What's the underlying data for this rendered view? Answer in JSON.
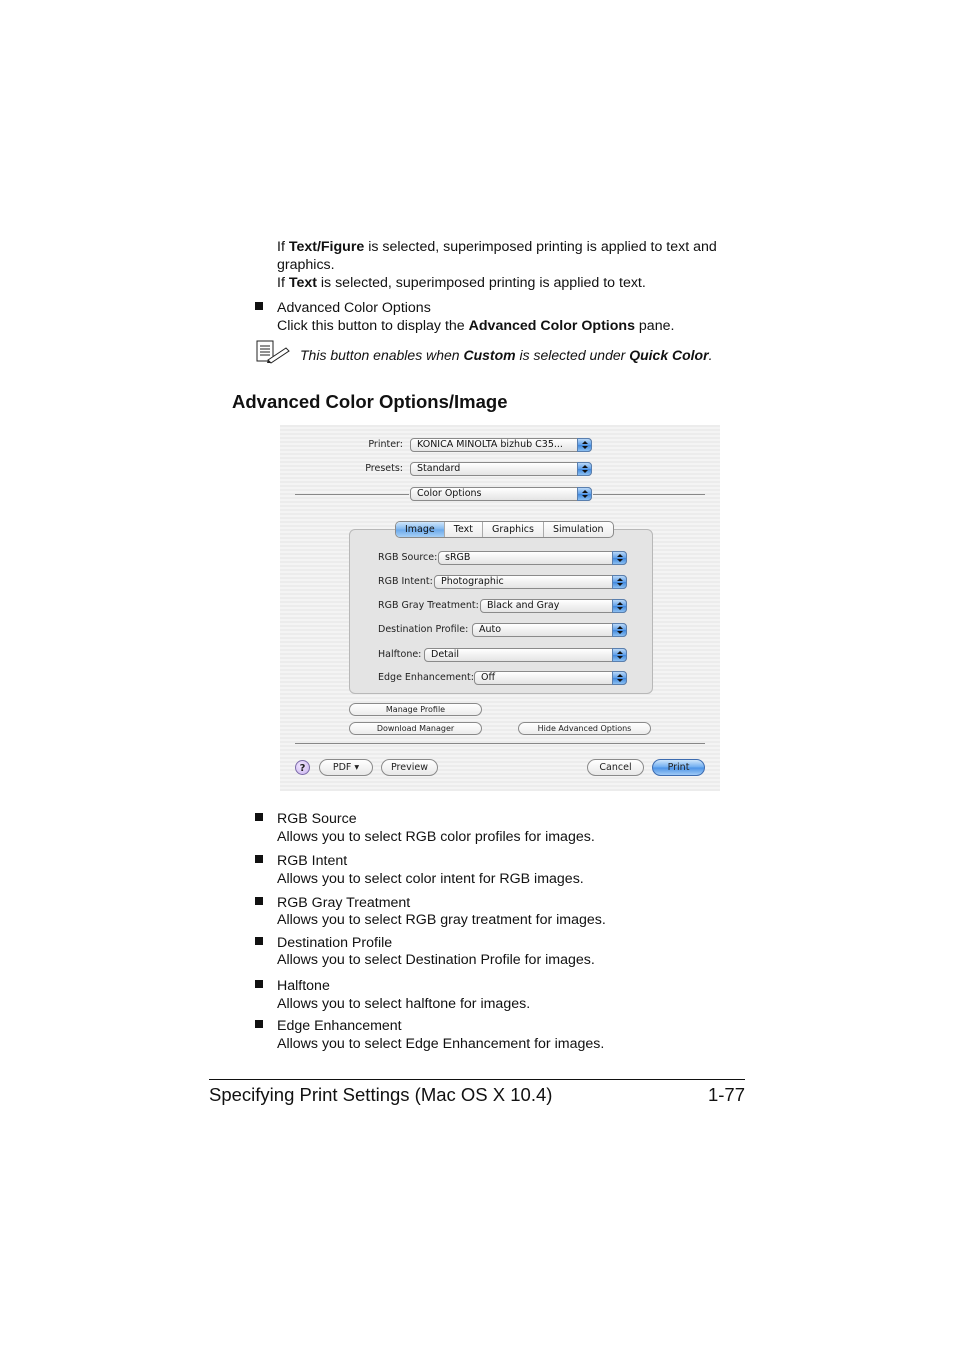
{
  "intro": {
    "line1_pre": "If ",
    "line1_bold": "Text/Figure",
    "line1_post": " is selected, superimposed printing is applied to text and",
    "line2": "graphics.",
    "line3_pre": "If ",
    "line3_bold": "Text",
    "line3_post": " is selected, superimposed printing is applied to text."
  },
  "advanced_item": {
    "title": "Advanced Color Options",
    "desc_pre": "Click this button to display the ",
    "desc_bold": "Advanced Color Options",
    "desc_post": " pane."
  },
  "note": {
    "icon": "note-pencil-icon",
    "pre": "This button enables when ",
    "bold1": "Custom",
    "mid": " is selected under ",
    "bold2": "Quick Color",
    "post": "."
  },
  "section_heading": "Advanced Color Options/Image",
  "dialog": {
    "printer_label": "Printer:",
    "printer_value": "KONICA MINOLTA bizhub C35...",
    "presets_label": "Presets:",
    "presets_value": "Standard",
    "pane_value": "Color Options",
    "tabs": [
      "Image",
      "Text",
      "Graphics",
      "Simulation"
    ],
    "active_tab": "Image",
    "fields": [
      {
        "label": "RGB Source:",
        "value": "sRGB"
      },
      {
        "label": "RGB Intent:",
        "value": "Photographic"
      },
      {
        "label": "RGB Gray Treatment:",
        "value": "Black and Gray"
      },
      {
        "label": "Destination Profile:",
        "value": "Auto"
      },
      {
        "label": "Halftone:",
        "value": "Detail"
      },
      {
        "label": "Edge Enhancement:",
        "value": "Off"
      }
    ],
    "manage_profile": "Manage Profile",
    "download_manager": "Download Manager",
    "hide_advanced": "Hide Advanced Options",
    "help": "?",
    "pdf": "PDF ▾",
    "preview": "Preview",
    "cancel": "Cancel",
    "print": "Print"
  },
  "descriptions": [
    {
      "title": "RGB Source",
      "desc": "Allows you to select RGB color profiles for images."
    },
    {
      "title": "RGB Intent",
      "desc": "Allows you to select color intent for RGB images."
    },
    {
      "title": "RGB Gray Treatment",
      "desc": "Allows you to select RGB gray treatment for images."
    },
    {
      "title": "Destination Profile",
      "desc": "Allows you to select Destination Profile for images."
    },
    {
      "title": "Halftone",
      "desc": "Allows you to select halftone for images."
    },
    {
      "title": "Edge Enhancement",
      "desc": "Allows you to select Edge Enhancement for images."
    }
  ],
  "footer": {
    "title": "Specifying Print Settings (Mac OS X 10.4)",
    "page": "1-77"
  }
}
